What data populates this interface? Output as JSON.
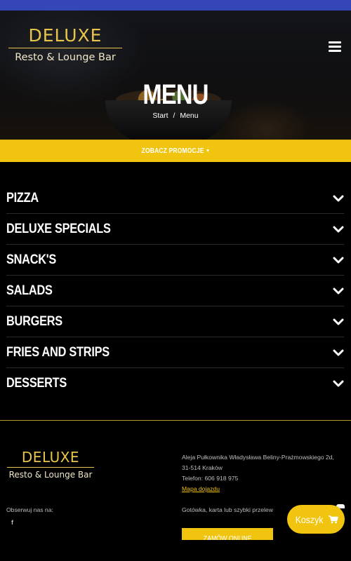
{
  "brand": {
    "title": "DELUXE",
    "subtitle": "Resto & Lounge Bar",
    "accent_color": "#f1c40f",
    "topbar_color": "#3546b8"
  },
  "header": {
    "menu_icon": "hamburger-icon"
  },
  "hero": {
    "title": "MENU",
    "breadcrumb": {
      "home": "Start",
      "separator": "/",
      "current": "Menu"
    }
  },
  "promo": {
    "label": "ZOBACZ PROMOCJE",
    "icon": "caret-down-icon"
  },
  "categories": [
    {
      "label": "PIZZA"
    },
    {
      "label": "DELUXE SPECIALS"
    },
    {
      "label": "SNACK'S"
    },
    {
      "label": "SALADS"
    },
    {
      "label": "BURGERS"
    },
    {
      "label": "FRIES AND STRIPS"
    },
    {
      "label": "DESSERTS"
    }
  ],
  "footer": {
    "address_line1": "Aleja Pułkownika Władysława Beliny-Prażmowskiego 2d,",
    "address_line2": "31-514 Kraków",
    "phone": "Telefon: 606 918 975",
    "map_link": "Mapa dojazdu",
    "follow_label": "Obserwuj nas na:",
    "facebook_icon": "f",
    "payment": "Gotówka, karta lub szybki przelew",
    "order_button": "ZAMÓW ONLINE"
  },
  "cart": {
    "label": "Koszyk",
    "icon": "cart-icon"
  }
}
